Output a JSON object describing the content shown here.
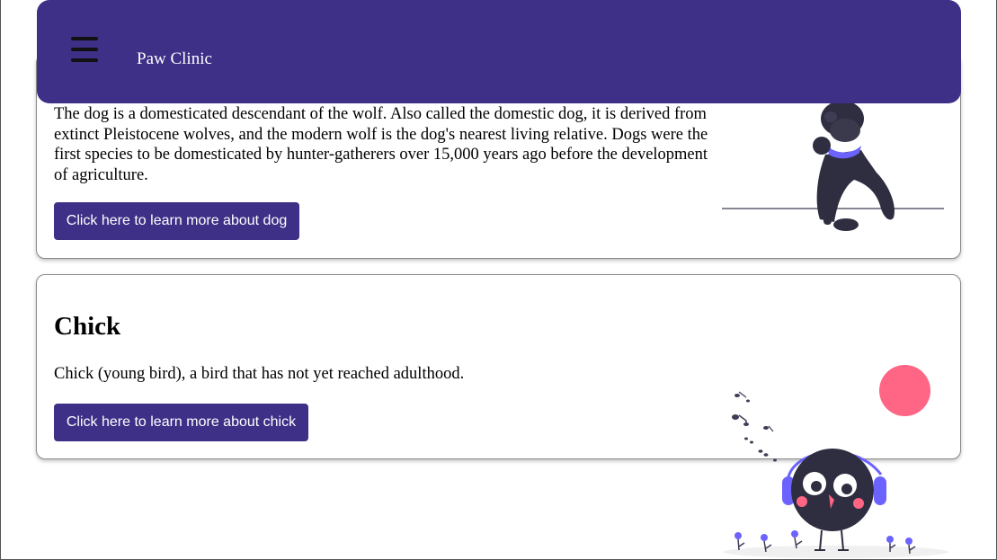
{
  "nav": {
    "brand": "Paw Clinic",
    "menu_icon": "hamburger-menu-icon"
  },
  "dog": {
    "description": "The dog is a domesticated descendant of the wolf. Also called the domestic dog, it is derived from extinct Pleistocene wolves, and the modern wolf is the dog's nearest living relative. Dogs were the first species to be domesticated by hunter-gatherers over 15,000 years ago before the development of agriculture.",
    "button_label": "Click here to learn more about dog"
  },
  "chick": {
    "title": "Chick",
    "description": "Chick (young bird), a bird that has not yet reached adulthood.",
    "button_label": "Click here to learn more about chick"
  },
  "colors": {
    "primary": "#3e2f87",
    "accent": "#6c63ff",
    "sun": "#ff6584",
    "dark": "#2f2e41"
  }
}
